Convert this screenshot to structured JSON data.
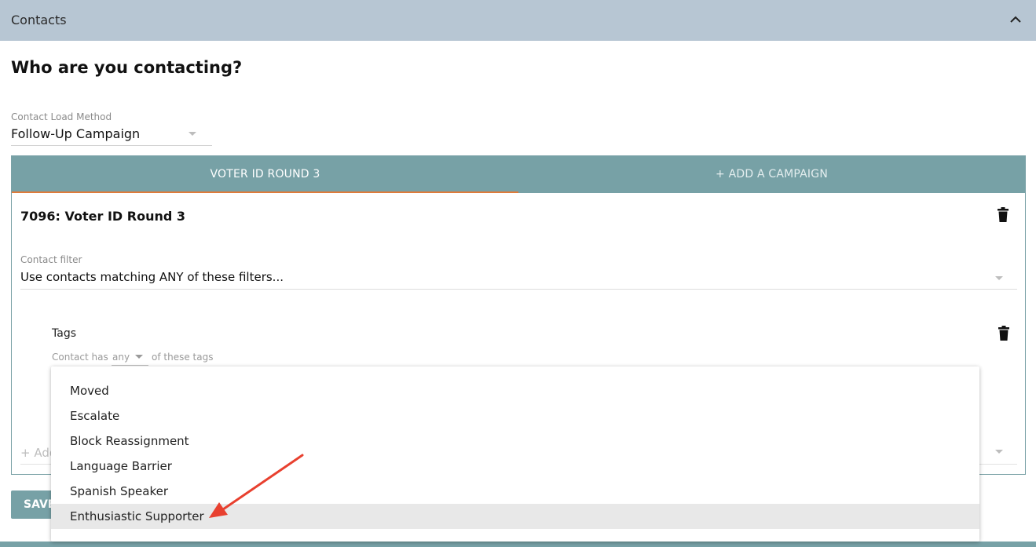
{
  "header": {
    "title": "Contacts",
    "collapse_icon": "chevron-up-icon"
  },
  "page": {
    "title": "Who are you contacting?"
  },
  "contact_load_method": {
    "label": "Contact Load Method",
    "value": "Follow-Up Campaign"
  },
  "tabs": [
    {
      "label": "VOTER ID ROUND 3",
      "active": true
    },
    {
      "label": "+ ADD A CAMPAIGN",
      "active": false
    }
  ],
  "campaign": {
    "title": "7096: Voter ID Round 3",
    "contact_filter": {
      "label": "Contact filter",
      "value": "Use contacts matching ANY of these filters..."
    },
    "tags_filter": {
      "label": "Tags",
      "prefix": "Contact has",
      "quantifier": "any",
      "suffix": "of these tags"
    },
    "add_filter_label": "+ Add"
  },
  "tag_menu": {
    "items": [
      "Moved",
      "Escalate",
      "Block Reassignment",
      "Language Barrier",
      "Spanish Speaker",
      "Enthusiastic Supporter"
    ],
    "highlighted_index": 5
  },
  "actions": {
    "save_label": "SAVE"
  },
  "colors": {
    "header_bg": "#b7c6d3",
    "tab_bg": "#77a1a6",
    "tab_underline": "#e07b39",
    "annotation_arrow": "#e8402f"
  }
}
